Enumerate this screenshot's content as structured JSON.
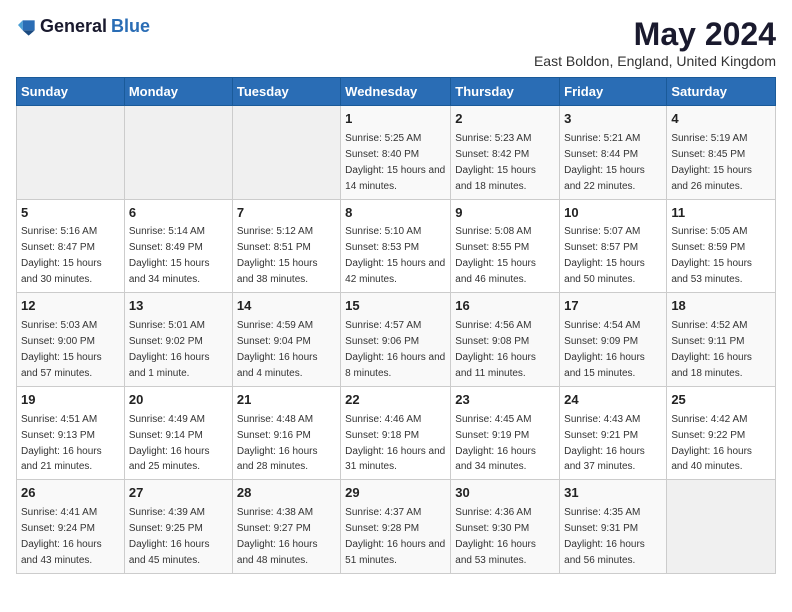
{
  "logo": {
    "general": "General",
    "blue": "Blue"
  },
  "title": "May 2024",
  "location": "East Boldon, England, United Kingdom",
  "weekdays": [
    "Sunday",
    "Monday",
    "Tuesday",
    "Wednesday",
    "Thursday",
    "Friday",
    "Saturday"
  ],
  "weeks": [
    [
      {
        "day": "",
        "info": ""
      },
      {
        "day": "",
        "info": ""
      },
      {
        "day": "",
        "info": ""
      },
      {
        "day": "1",
        "info": "Sunrise: 5:25 AM\nSunset: 8:40 PM\nDaylight: 15 hours and 14 minutes."
      },
      {
        "day": "2",
        "info": "Sunrise: 5:23 AM\nSunset: 8:42 PM\nDaylight: 15 hours and 18 minutes."
      },
      {
        "day": "3",
        "info": "Sunrise: 5:21 AM\nSunset: 8:44 PM\nDaylight: 15 hours and 22 minutes."
      },
      {
        "day": "4",
        "info": "Sunrise: 5:19 AM\nSunset: 8:45 PM\nDaylight: 15 hours and 26 minutes."
      }
    ],
    [
      {
        "day": "5",
        "info": "Sunrise: 5:16 AM\nSunset: 8:47 PM\nDaylight: 15 hours and 30 minutes."
      },
      {
        "day": "6",
        "info": "Sunrise: 5:14 AM\nSunset: 8:49 PM\nDaylight: 15 hours and 34 minutes."
      },
      {
        "day": "7",
        "info": "Sunrise: 5:12 AM\nSunset: 8:51 PM\nDaylight: 15 hours and 38 minutes."
      },
      {
        "day": "8",
        "info": "Sunrise: 5:10 AM\nSunset: 8:53 PM\nDaylight: 15 hours and 42 minutes."
      },
      {
        "day": "9",
        "info": "Sunrise: 5:08 AM\nSunset: 8:55 PM\nDaylight: 15 hours and 46 minutes."
      },
      {
        "day": "10",
        "info": "Sunrise: 5:07 AM\nSunset: 8:57 PM\nDaylight: 15 hours and 50 minutes."
      },
      {
        "day": "11",
        "info": "Sunrise: 5:05 AM\nSunset: 8:59 PM\nDaylight: 15 hours and 53 minutes."
      }
    ],
    [
      {
        "day": "12",
        "info": "Sunrise: 5:03 AM\nSunset: 9:00 PM\nDaylight: 15 hours and 57 minutes."
      },
      {
        "day": "13",
        "info": "Sunrise: 5:01 AM\nSunset: 9:02 PM\nDaylight: 16 hours and 1 minute."
      },
      {
        "day": "14",
        "info": "Sunrise: 4:59 AM\nSunset: 9:04 PM\nDaylight: 16 hours and 4 minutes."
      },
      {
        "day": "15",
        "info": "Sunrise: 4:57 AM\nSunset: 9:06 PM\nDaylight: 16 hours and 8 minutes."
      },
      {
        "day": "16",
        "info": "Sunrise: 4:56 AM\nSunset: 9:08 PM\nDaylight: 16 hours and 11 minutes."
      },
      {
        "day": "17",
        "info": "Sunrise: 4:54 AM\nSunset: 9:09 PM\nDaylight: 16 hours and 15 minutes."
      },
      {
        "day": "18",
        "info": "Sunrise: 4:52 AM\nSunset: 9:11 PM\nDaylight: 16 hours and 18 minutes."
      }
    ],
    [
      {
        "day": "19",
        "info": "Sunrise: 4:51 AM\nSunset: 9:13 PM\nDaylight: 16 hours and 21 minutes."
      },
      {
        "day": "20",
        "info": "Sunrise: 4:49 AM\nSunset: 9:14 PM\nDaylight: 16 hours and 25 minutes."
      },
      {
        "day": "21",
        "info": "Sunrise: 4:48 AM\nSunset: 9:16 PM\nDaylight: 16 hours and 28 minutes."
      },
      {
        "day": "22",
        "info": "Sunrise: 4:46 AM\nSunset: 9:18 PM\nDaylight: 16 hours and 31 minutes."
      },
      {
        "day": "23",
        "info": "Sunrise: 4:45 AM\nSunset: 9:19 PM\nDaylight: 16 hours and 34 minutes."
      },
      {
        "day": "24",
        "info": "Sunrise: 4:43 AM\nSunset: 9:21 PM\nDaylight: 16 hours and 37 minutes."
      },
      {
        "day": "25",
        "info": "Sunrise: 4:42 AM\nSunset: 9:22 PM\nDaylight: 16 hours and 40 minutes."
      }
    ],
    [
      {
        "day": "26",
        "info": "Sunrise: 4:41 AM\nSunset: 9:24 PM\nDaylight: 16 hours and 43 minutes."
      },
      {
        "day": "27",
        "info": "Sunrise: 4:39 AM\nSunset: 9:25 PM\nDaylight: 16 hours and 45 minutes."
      },
      {
        "day": "28",
        "info": "Sunrise: 4:38 AM\nSunset: 9:27 PM\nDaylight: 16 hours and 48 minutes."
      },
      {
        "day": "29",
        "info": "Sunrise: 4:37 AM\nSunset: 9:28 PM\nDaylight: 16 hours and 51 minutes."
      },
      {
        "day": "30",
        "info": "Sunrise: 4:36 AM\nSunset: 9:30 PM\nDaylight: 16 hours and 53 minutes."
      },
      {
        "day": "31",
        "info": "Sunrise: 4:35 AM\nSunset: 9:31 PM\nDaylight: 16 hours and 56 minutes."
      },
      {
        "day": "",
        "info": ""
      }
    ]
  ]
}
